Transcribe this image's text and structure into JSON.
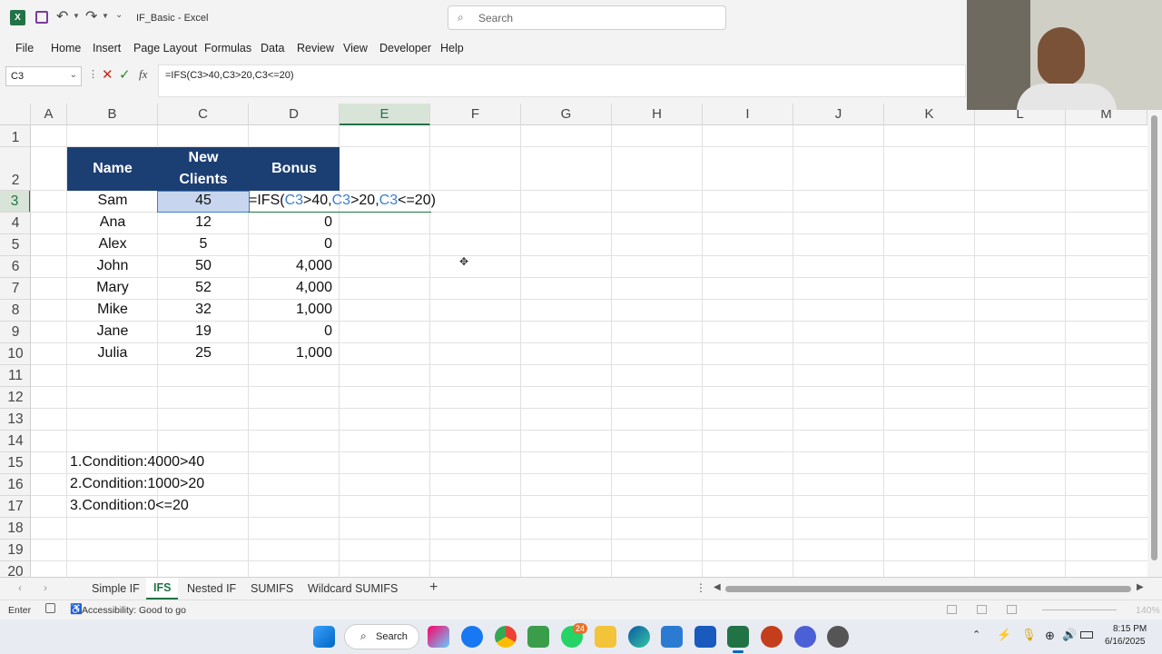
{
  "app": {
    "filename": "IF_Basic",
    "separator": "-",
    "app_name": "Excel",
    "search_placeholder": "Search"
  },
  "menu": [
    "File",
    "Home",
    "Insert",
    "Page Layout",
    "Formulas",
    "Data",
    "Review",
    "View",
    "Developer",
    "Help"
  ],
  "formula_bar": {
    "name_box": "C3",
    "fx": "fx",
    "formula": "=IFS(C3>40,C3>20,C3<=20)"
  },
  "columns": [
    "A",
    "B",
    "C",
    "D",
    "E",
    "F",
    "G",
    "H",
    "I",
    "J",
    "K",
    "L",
    "M"
  ],
  "rows": [
    "1",
    "2",
    "3",
    "4",
    "5",
    "6",
    "7",
    "8",
    "9",
    "10",
    "11",
    "12",
    "13",
    "14",
    "15",
    "16",
    "17",
    "18",
    "19",
    "20"
  ],
  "table": {
    "headers": {
      "name": "Name",
      "clients_line1": "New",
      "clients_line2": "Clients",
      "bonus": "Bonus"
    },
    "rows": [
      {
        "name": "Sam",
        "clients": "45",
        "bonus": ""
      },
      {
        "name": "Ana",
        "clients": "12",
        "bonus": "0"
      },
      {
        "name": "Alex",
        "clients": "5",
        "bonus": "0"
      },
      {
        "name": "John",
        "clients": "50",
        "bonus": "4,000"
      },
      {
        "name": "Mary",
        "clients": "52",
        "bonus": "4,000"
      },
      {
        "name": "Mike",
        "clients": "32",
        "bonus": "1,000"
      },
      {
        "name": "Jane",
        "clients": "19",
        "bonus": "0"
      },
      {
        "name": "Julia",
        "clients": "25",
        "bonus": "1,000"
      }
    ],
    "header_color": "#1c3f73"
  },
  "edit_formula": {
    "p1": "=IFS(",
    "r1": "C3",
    "p2": ">40,",
    "r2": "C3",
    "p3": ">20,",
    "r3": "C3",
    "p4": "<=20)"
  },
  "notes": [
    "1.Condition:4000>40",
    "2.Condition:1000>20",
    "3.Condition:0<=20"
  ],
  "sheets": [
    "Simple IF",
    "IFS",
    "Nested IF",
    "SUMIFS",
    "Wildcard SUMIFS"
  ],
  "active_sheet": "IFS",
  "status": {
    "mode": "Enter",
    "accessibility": "Accessibility: Good to go",
    "zoom": "140%"
  },
  "taskbar": {
    "search": "Search",
    "badge": "24",
    "time": "8:15 PM",
    "date": "6/16/2025"
  },
  "colors": {
    "accent": "#217346",
    "ref_blue": "#3b7fd0",
    "selection": "#c7d6ee"
  }
}
